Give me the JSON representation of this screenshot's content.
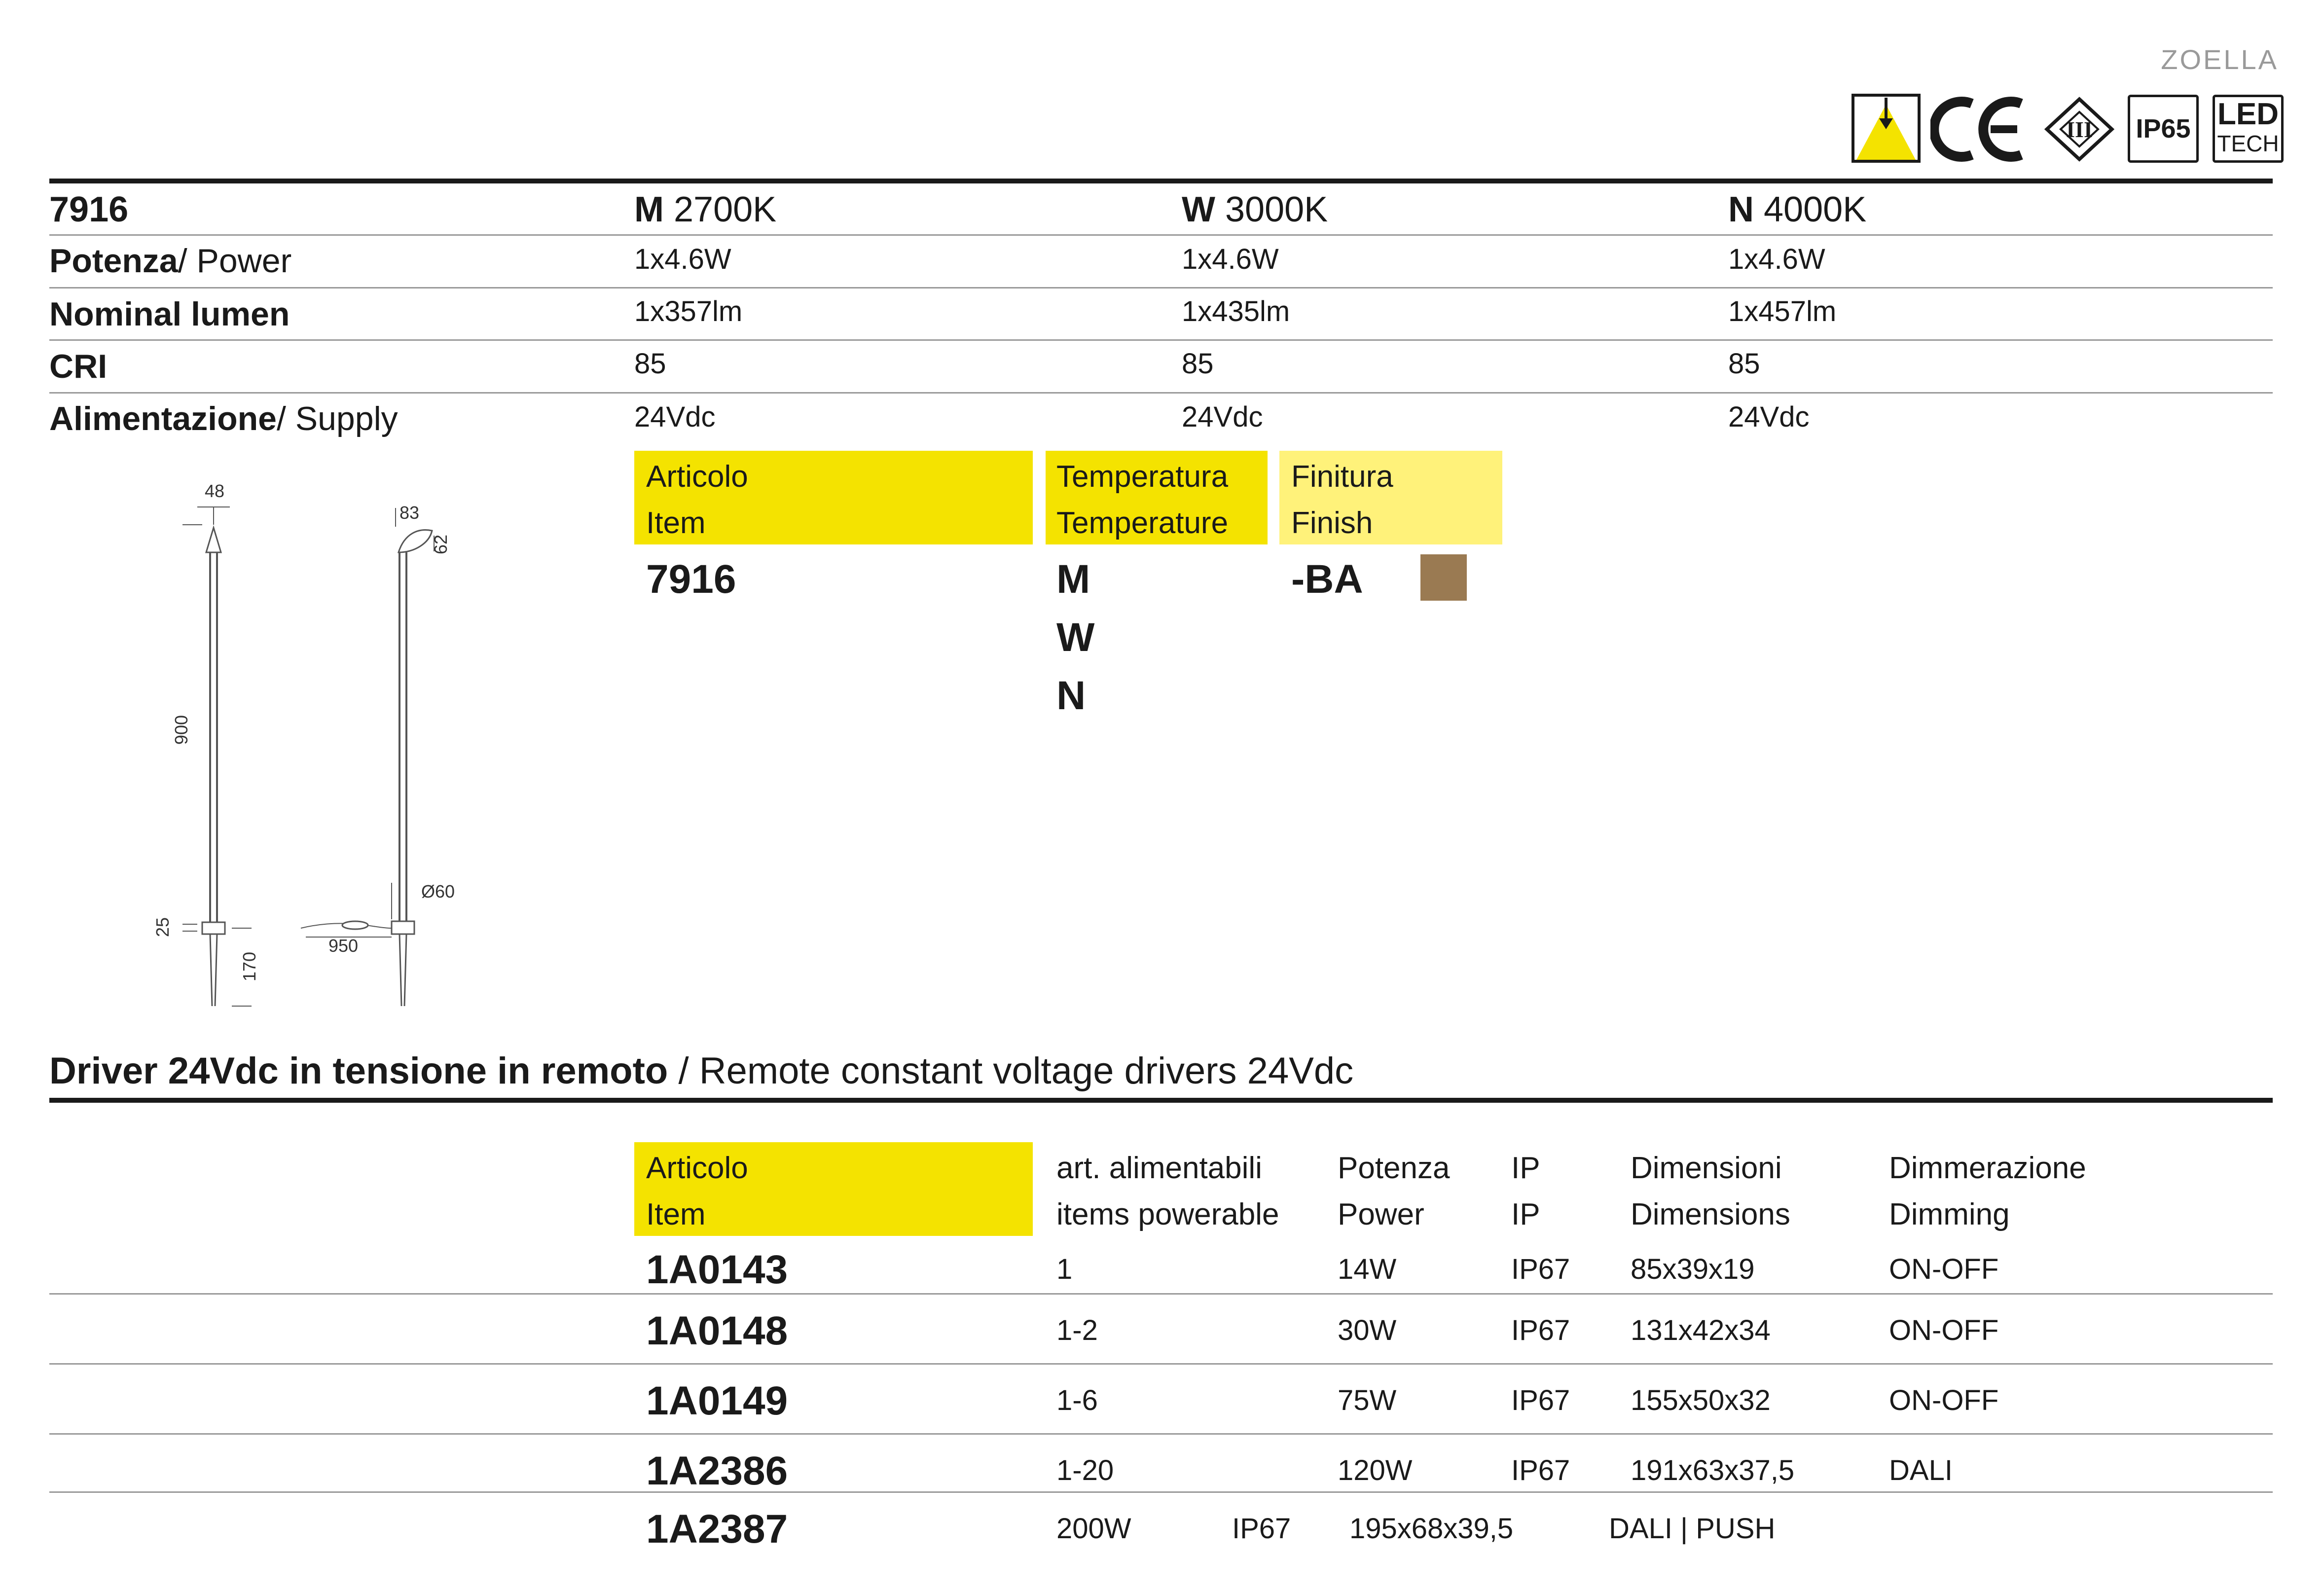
{
  "brand": "ZOELLA",
  "certs": {
    "ip": "IP65",
    "led_line1": "LED",
    "led_line2": "TECH",
    "class": "III"
  },
  "spec": {
    "code": "7916",
    "cols": [
      {
        "letter": "M",
        "temp": "2700K"
      },
      {
        "letter": "W",
        "temp": "3000K"
      },
      {
        "letter": "N",
        "temp": "4000K"
      }
    ],
    "rows": [
      {
        "label_bold": "Potenza",
        "label_rest": "/ Power",
        "values": [
          "1x4.6W",
          "1x4.6W",
          "1x4.6W"
        ]
      },
      {
        "label_bold": "Nominal lumen",
        "label_rest": "",
        "values": [
          "1x357lm",
          "1x435lm",
          "1x457lm"
        ]
      },
      {
        "label_bold": "CRI",
        "label_rest": "",
        "values": [
          "85",
          "85",
          "85"
        ]
      },
      {
        "label_bold": "Alimentazione",
        "label_rest": "/ Supply",
        "values": [
          "24Vdc",
          "24Vdc",
          "24Vdc"
        ]
      }
    ]
  },
  "order": {
    "item_h1": "Articolo",
    "item_h2": "Item",
    "temp_h1": "Temperatura",
    "temp_h2": "Temperature",
    "finish_h1": "Finitura",
    "finish_h2": "Finish",
    "item_code": "7916",
    "temps": [
      "M",
      "W",
      "N"
    ],
    "finish_code": "-BA",
    "finish_color": "#9a7a52"
  },
  "drawing": {
    "d48": "48",
    "d83": "83",
    "d62": "62",
    "d900": "900",
    "d25": "25",
    "d170": "170",
    "d950": "950",
    "d60": "Ø60"
  },
  "drivers": {
    "title_bold": "Driver 24Vdc in tensione in remoto",
    "title_rest": " / Remote constant voltage drivers 24Vdc",
    "headers": [
      {
        "l1": "Articolo",
        "l2": "Item"
      },
      {
        "l1": "art. alimentabili",
        "l2": "items powerable"
      },
      {
        "l1": "Potenza",
        "l2": "Power"
      },
      {
        "l1": "IP",
        "l2": "IP"
      },
      {
        "l1": "Dimensioni",
        "l2": "Dimensions"
      },
      {
        "l1": "Dimmerazione",
        "l2": "Dimming"
      }
    ],
    "rows": [
      {
        "code": "1A0143",
        "items": "1",
        "power": "14W",
        "ip": "IP67",
        "dims": "85x39x19",
        "dim": "ON-OFF"
      },
      {
        "code": "1A0148",
        "items": "1-2",
        "power": "30W",
        "ip": "IP67",
        "dims": "131x42x34",
        "dim": "ON-OFF"
      },
      {
        "code": "1A0149",
        "items": "1-6",
        "power": "75W",
        "ip": "IP67",
        "dims": "155x50x32",
        "dim": "ON-OFF"
      },
      {
        "code": "1A2386",
        "items": "1-20",
        "power": "120W",
        "ip": "IP67",
        "dims": "191x63x37,5",
        "dim": "DALI"
      }
    ],
    "last_row": {
      "code": "1A2387",
      "power": "200W",
      "ip": "IP67",
      "dims": "195x68x39,5",
      "dim": "DALI | PUSH"
    }
  }
}
